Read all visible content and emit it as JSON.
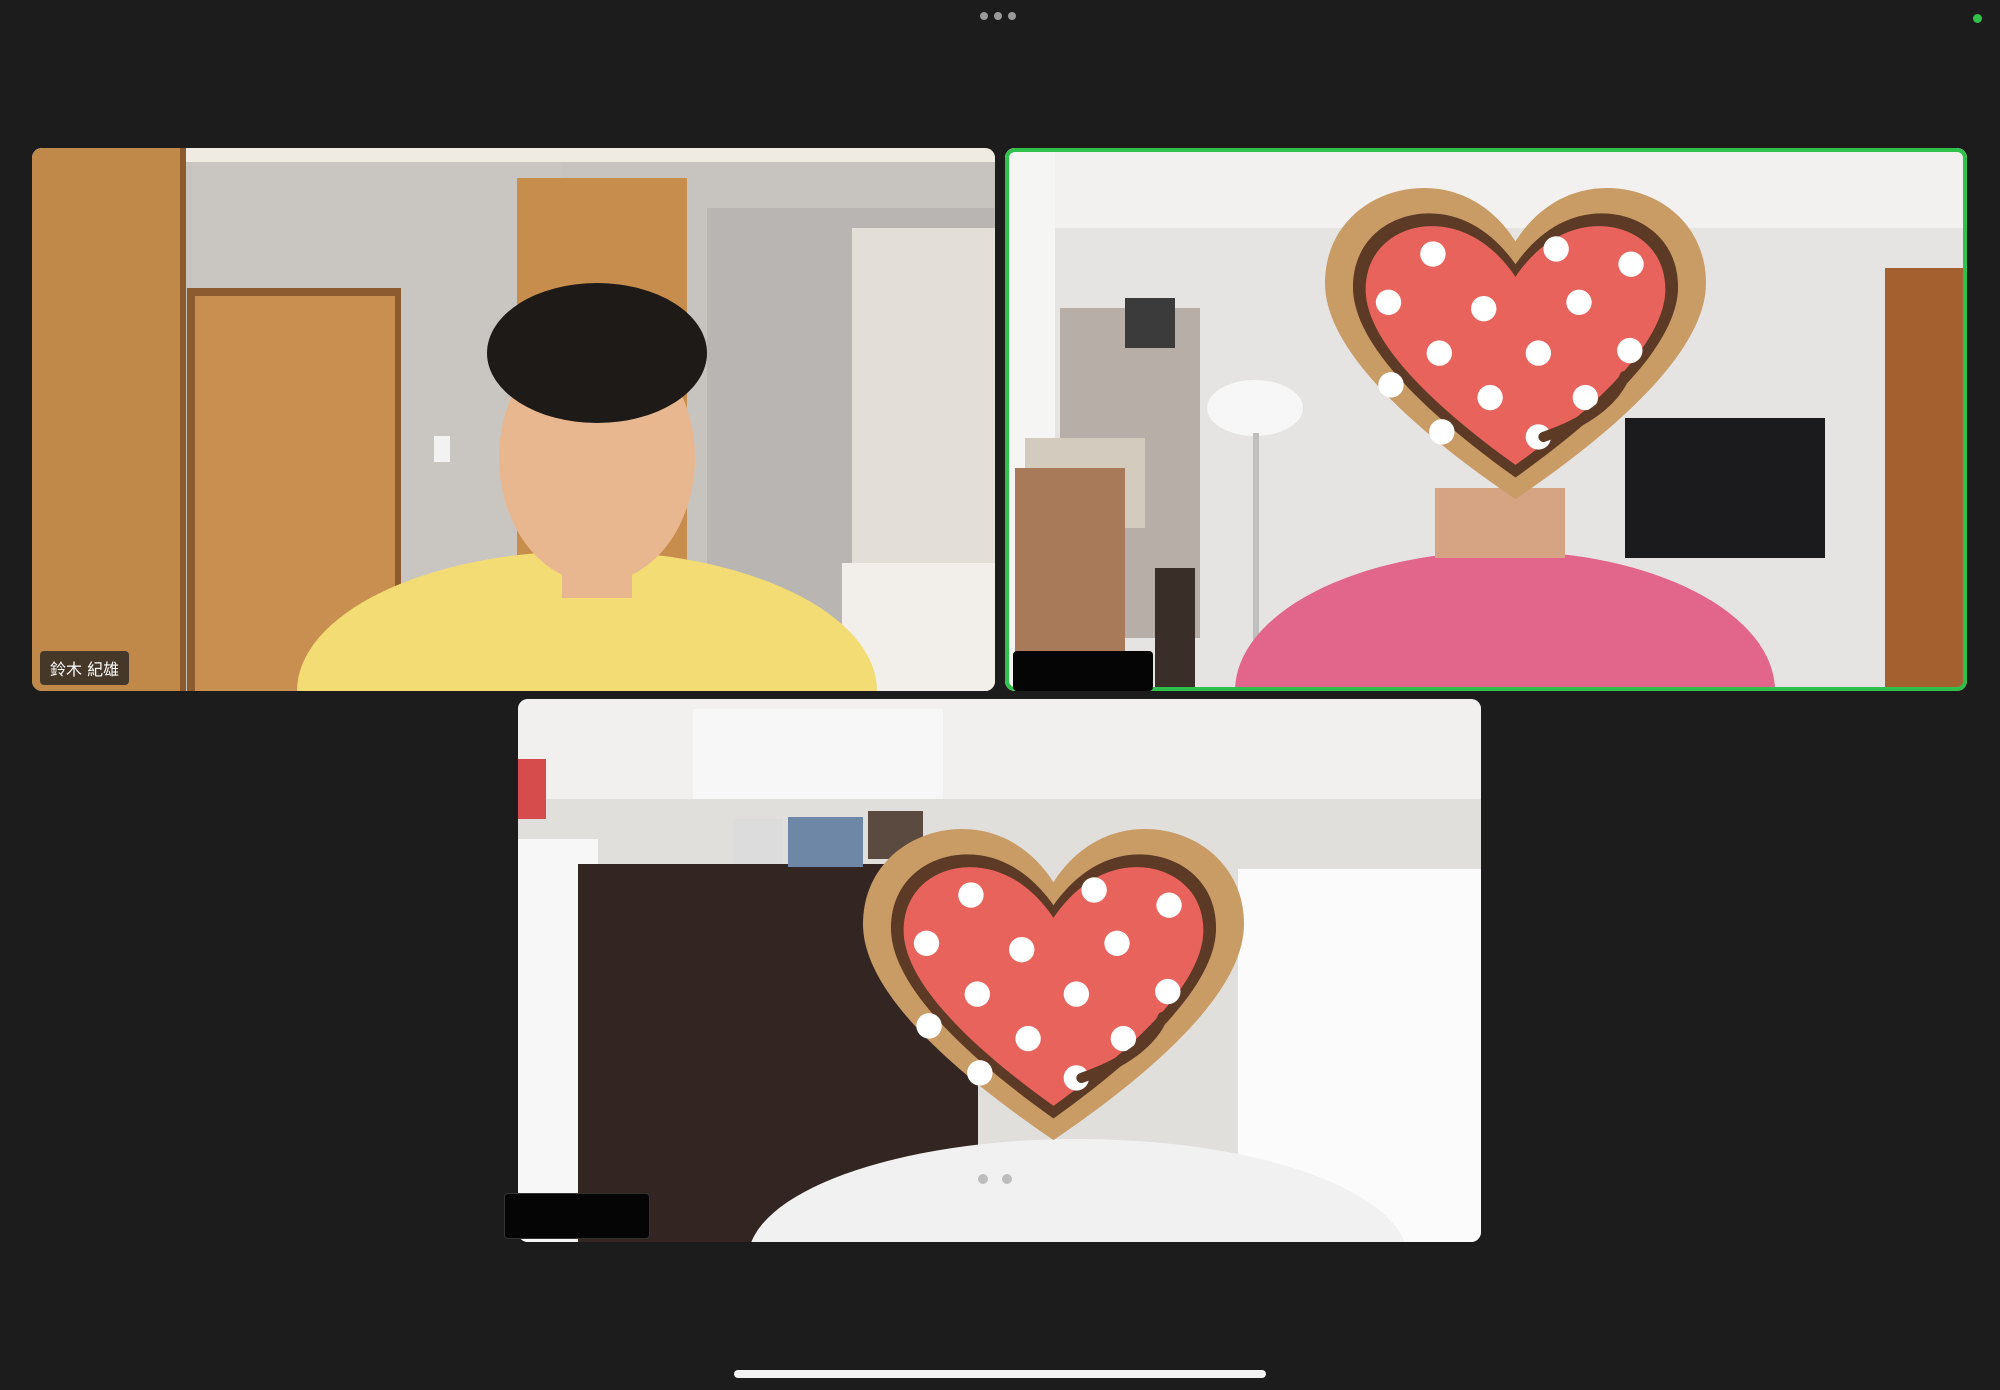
{
  "app": {
    "top_menu_icon": "more-horizontal-icon",
    "status_color": "#2fc24a"
  },
  "participants": [
    {
      "name": "鈴木 紀雄",
      "shirt": "yellow",
      "active_speaker": false
    },
    {
      "name": "",
      "shirt": "pink",
      "active_speaker": true,
      "face_cover": "heart-cookie-sticker"
    },
    {
      "name": "",
      "shirt": "white",
      "active_speaker": false,
      "face_cover": "heart-cookie-sticker"
    }
  ],
  "gallery": {
    "page_count": 2
  }
}
